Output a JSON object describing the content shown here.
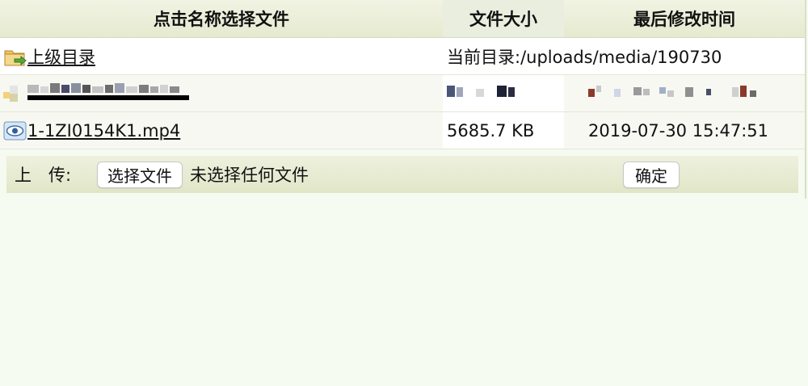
{
  "header": {
    "name_col": "点击名称选择文件",
    "size_col": "文件大小",
    "time_col": "最后修改时间"
  },
  "rows": {
    "parent": {
      "name": "上级目录",
      "current_dir": "当前目录:/uploads/media/190730"
    },
    "file": {
      "name": "1-1ZI0154K1.mp4",
      "size": "5685.7 KB",
      "modified": "2019-07-30 15:47:51"
    }
  },
  "upload": {
    "label": "上　传:",
    "choose_button": "选择文件",
    "no_file_text": "未选择任何文件",
    "ok_button": "确定"
  },
  "icons": {
    "parent_dir": "folder-up-icon",
    "redacted_row": "folder-icon",
    "file": "video-file-icon"
  },
  "colors": {
    "page_background": "#f6fbf1",
    "header_background": "#e6ead0",
    "upload_bar": "#e1e6c8"
  }
}
